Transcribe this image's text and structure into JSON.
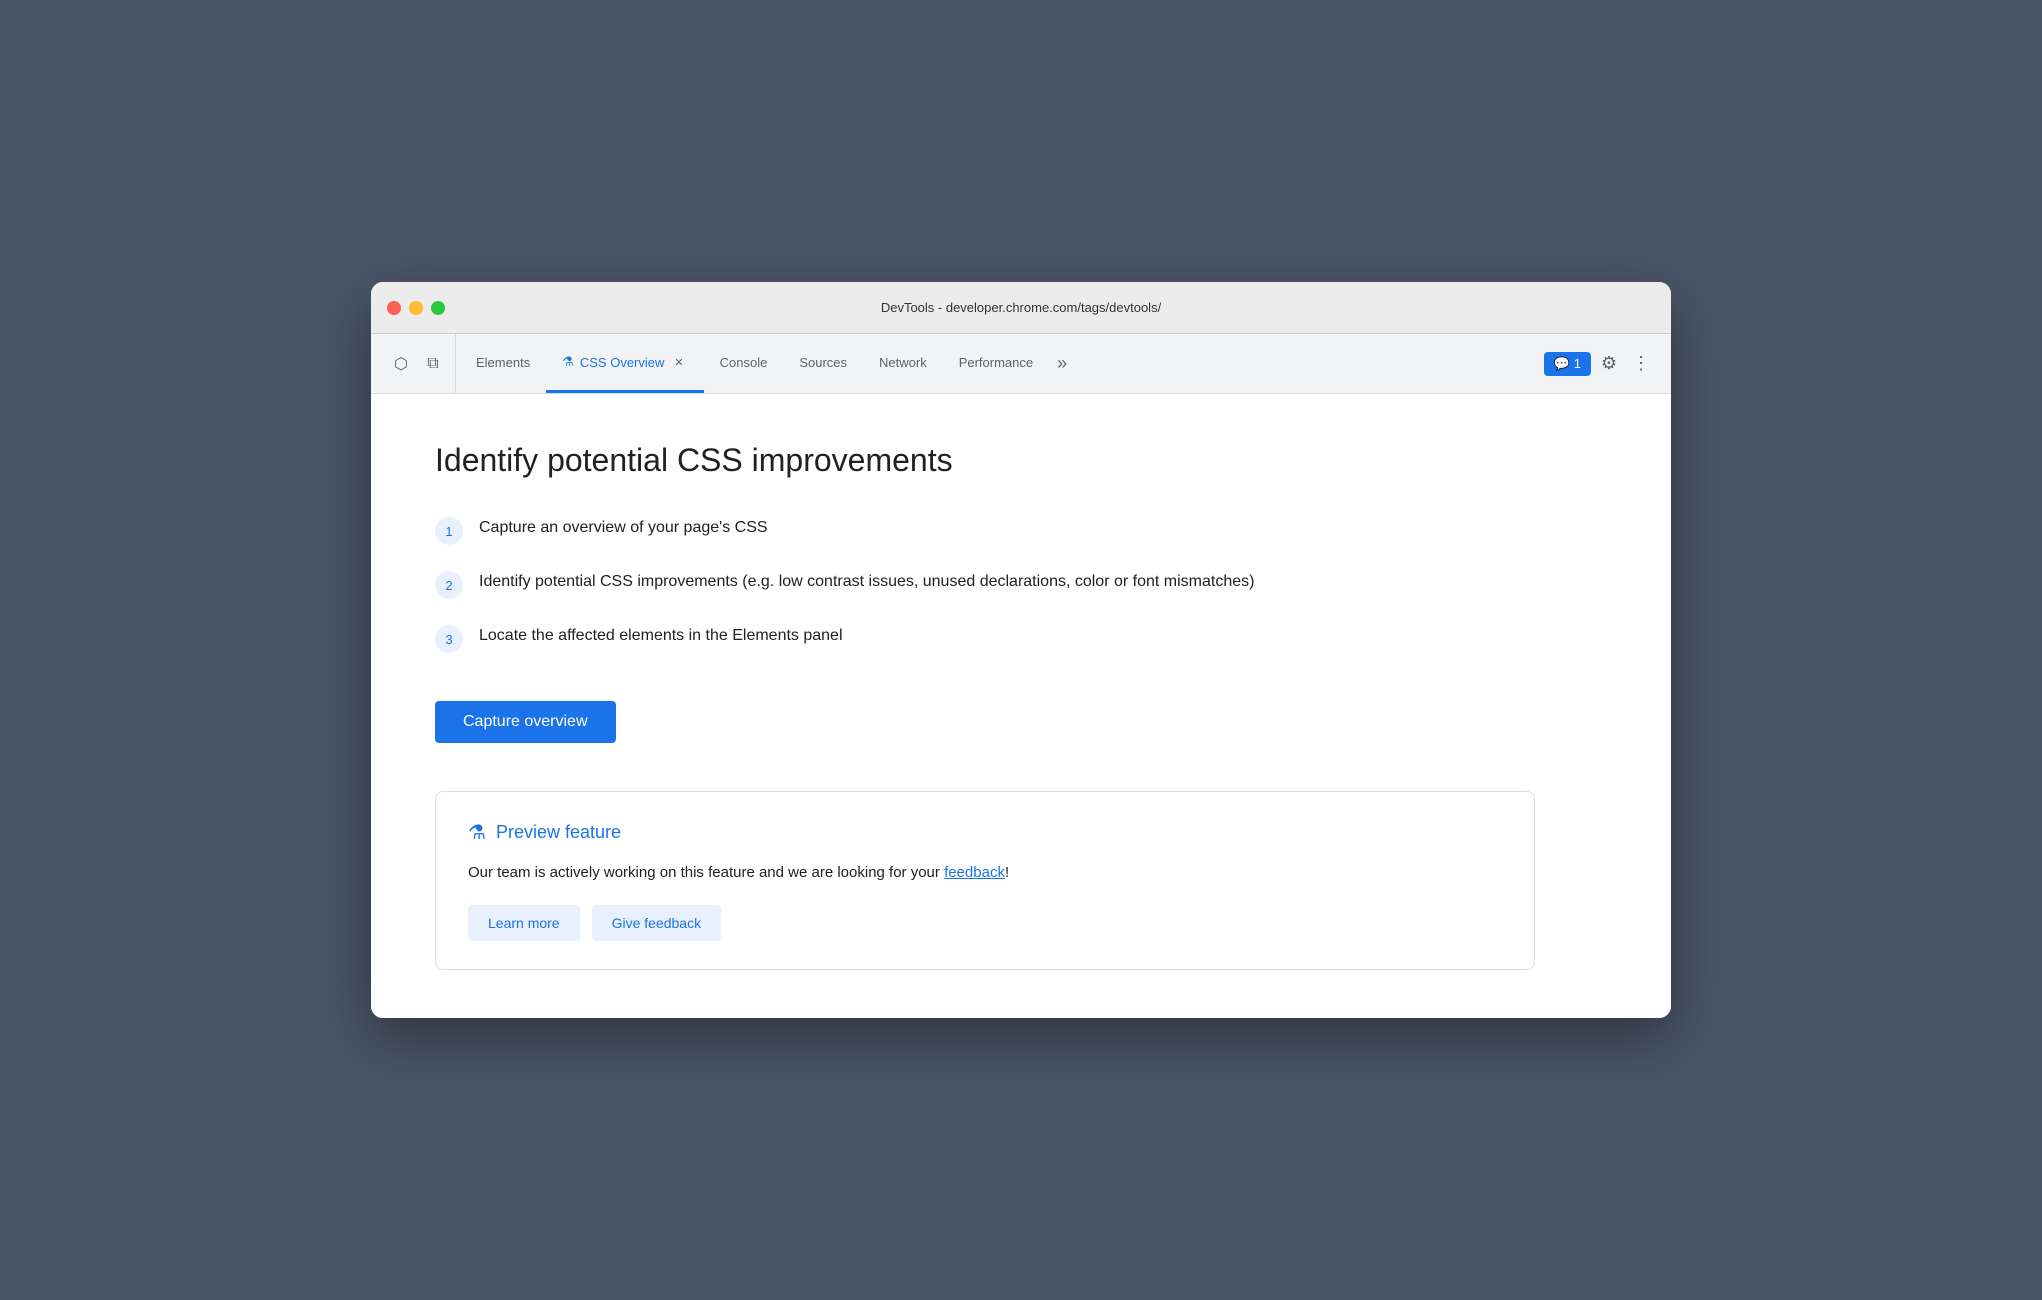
{
  "window": {
    "title": "DevTools - developer.chrome.com/tags/devtools/"
  },
  "traffic_lights": {
    "close_label": "close",
    "minimize_label": "minimize",
    "maximize_label": "maximize"
  },
  "toolbar": {
    "tabs": [
      {
        "id": "elements",
        "label": "Elements",
        "active": false
      },
      {
        "id": "css-overview",
        "label": "CSS Overview",
        "active": true,
        "has_flask": true,
        "has_close": true
      },
      {
        "id": "console",
        "label": "Console",
        "active": false
      },
      {
        "id": "sources",
        "label": "Sources",
        "active": false
      },
      {
        "id": "network",
        "label": "Network",
        "active": false
      },
      {
        "id": "performance",
        "label": "Performance",
        "active": false
      }
    ],
    "more_tabs_label": "»",
    "notifications_count": "1",
    "settings_label": "⚙",
    "more_options_label": "⋮"
  },
  "main": {
    "page_title": "Identify potential CSS improvements",
    "steps": [
      {
        "number": "1",
        "text": "Capture an overview of your page's CSS"
      },
      {
        "number": "2",
        "text": "Identify potential CSS improvements (e.g. low contrast issues, unused declarations, color or font mismatches)"
      },
      {
        "number": "3",
        "text": "Locate the affected elements in the Elements panel"
      }
    ],
    "capture_button_label": "Capture overview",
    "preview_feature": {
      "title": "Preview feature",
      "description_before": "Our team is actively working on this feature and we are looking for your ",
      "feedback_link_text": "feedback",
      "description_after": "!",
      "feedback_url": "#"
    }
  },
  "icons": {
    "cursor": "↖",
    "layers": "⧉",
    "flask": "⚗",
    "chat_bubble": "💬",
    "settings": "⚙",
    "more": "⋮"
  },
  "colors": {
    "accent": "#1a73e8",
    "active_tab_border": "#1a73e8"
  }
}
